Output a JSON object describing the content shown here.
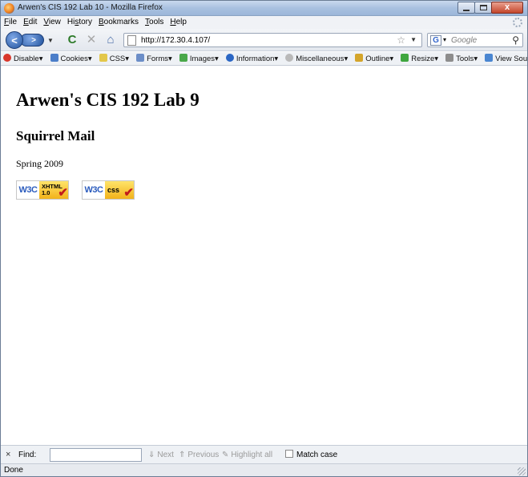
{
  "window": {
    "title": "Arwen's CIS 192 Lab 10 - Mozilla Firefox",
    "icon": "firefox-icon",
    "controls": {
      "minimize_icon": "minimize-icon",
      "maximize_icon": "maximize-icon",
      "close_glyph": "x"
    }
  },
  "menubar": {
    "items": [
      {
        "pre": "",
        "u": "F",
        "post": "ile"
      },
      {
        "pre": "",
        "u": "E",
        "post": "dit"
      },
      {
        "pre": "",
        "u": "V",
        "post": "iew"
      },
      {
        "pre": "Hi",
        "u": "s",
        "post": "tory"
      },
      {
        "pre": "",
        "u": "B",
        "post": "ookmarks"
      },
      {
        "pre": "",
        "u": "T",
        "post": "ools"
      },
      {
        "pre": "",
        "u": "H",
        "post": "elp"
      }
    ]
  },
  "navbar": {
    "back_glyph": "<",
    "forward_glyph": ">",
    "reload_glyph": "C",
    "stop_glyph": "✕",
    "home_glyph": "⌂",
    "url": "http://172.30.4.107/",
    "search_placeholder": "Google",
    "search_engine_glyph": "G"
  },
  "devbar": {
    "items": [
      {
        "label": "Disable",
        "icon": "disable-icon",
        "color": "#d9372b"
      },
      {
        "label": "Cookies",
        "icon": "cookies-icon",
        "color": "#4b7ec9"
      },
      {
        "label": "CSS",
        "icon": "css-icon",
        "color": "#e3c74a"
      },
      {
        "label": "Forms",
        "icon": "forms-icon",
        "color": "#6c8ec8"
      },
      {
        "label": "Images",
        "icon": "images-icon",
        "color": "#4aa84a"
      },
      {
        "label": "Information",
        "icon": "information-icon",
        "color": "#2a66c4"
      },
      {
        "label": "Miscellaneous",
        "icon": "miscellaneous-icon",
        "color": "#b9b9b9"
      },
      {
        "label": "Outline",
        "icon": "outline-icon",
        "color": "#d4a52b"
      },
      {
        "label": "Resize",
        "icon": "resize-icon",
        "color": "#3fa63f"
      },
      {
        "label": "Tools",
        "icon": "tools-icon",
        "color": "#8d8d8d"
      },
      {
        "label": "View Source",
        "icon": "view-source-icon",
        "color": "#4a86d1"
      }
    ]
  },
  "page": {
    "heading": "Arwen's CIS 192 Lab 9",
    "subheading": "Squirrel Mail",
    "text": "Spring 2009",
    "badges": {
      "w3c": "W3C",
      "xhtml_line1": "XHTML",
      "xhtml_line2": "1.0",
      "css": "css",
      "check_glyph": "✔"
    }
  },
  "findbar": {
    "close_glyph": "×",
    "label": "Find:",
    "value": "",
    "next": "Next",
    "previous": "Previous",
    "highlight": "Highlight all",
    "match_case": "Match case"
  },
  "status": {
    "text": "Done"
  }
}
